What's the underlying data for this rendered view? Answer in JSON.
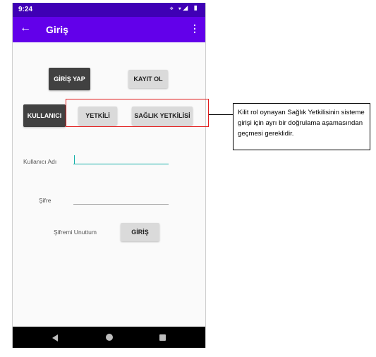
{
  "status_bar": {
    "time": "9:24",
    "icons": "⌖ ▾◢ ▮"
  },
  "app_bar": {
    "title": "Giriş",
    "back_icon": "←",
    "menu_icon": "⋮"
  },
  "toggle_row_1": {
    "login_label": "GİRİŞ YAP",
    "register_label": "KAYIT OL"
  },
  "toggle_row_2": {
    "user_label": "KULLANICI",
    "authority_label": "YETKİLİ",
    "health_authority_label": "SAĞLIK YETKİLİSİ"
  },
  "form": {
    "username_label": "Kullanıcı Adı",
    "username_value": "",
    "password_label": "Şifre",
    "password_value": "",
    "forgot_password": "Şifremi Unuttum",
    "submit_label": "GİRİŞ"
  },
  "annotation": {
    "text": "Kilit rol oynayan Sağlık Yetkilisinin sisteme girişi için ayrı bir doğrulama aşamasından geçmesi gereklidir.",
    "highlight_color": "#e21b1b"
  },
  "colors": {
    "app_bar": "#6200ea",
    "status_bar": "#3f00b5",
    "accent": "#15b0a8"
  }
}
